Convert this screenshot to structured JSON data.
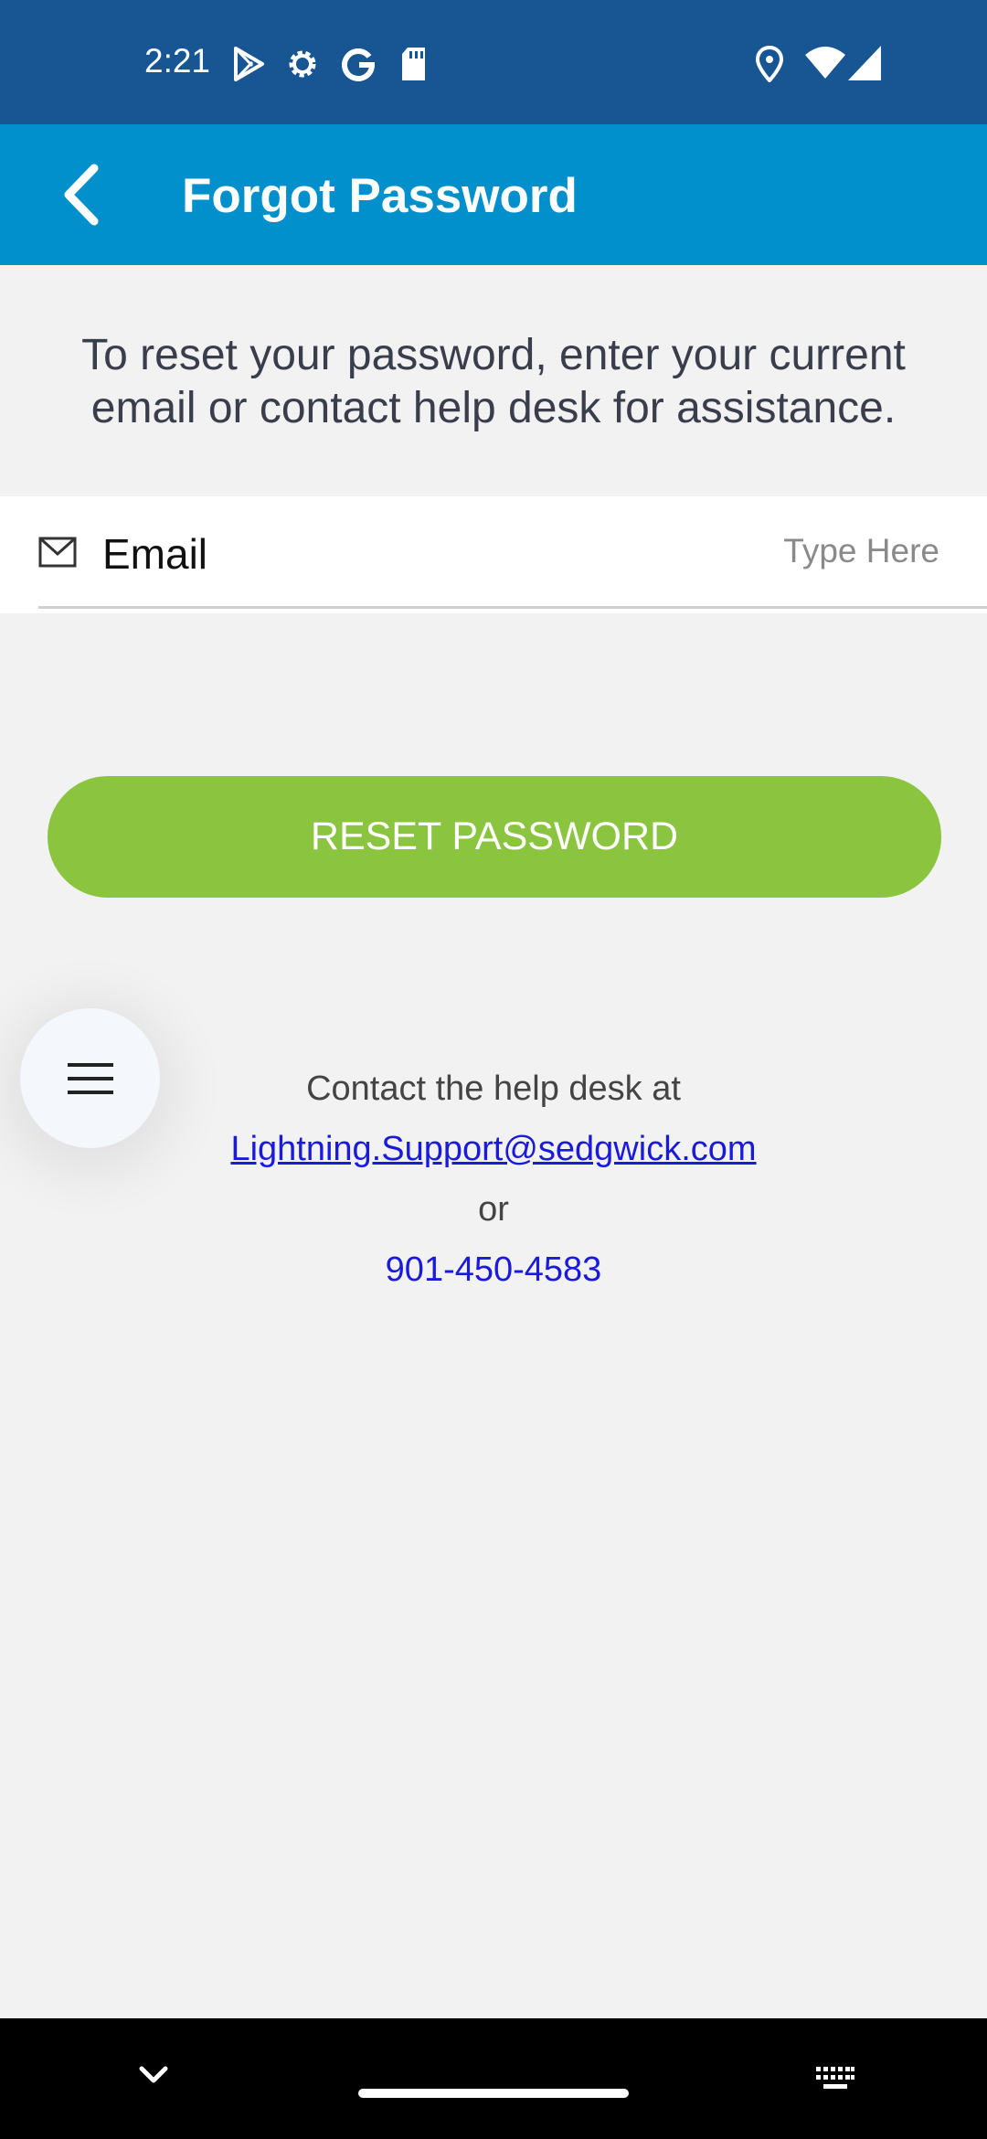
{
  "status_bar": {
    "time": "2:21",
    "icons_left": [
      "play-store-icon",
      "settings-icon",
      "google-icon",
      "sd-card-icon"
    ],
    "icons_right": [
      "location-icon",
      "wifi-icon",
      "cell-signal-icon"
    ]
  },
  "app_bar": {
    "title": "Forgot Password",
    "back_icon": "chevron-left-icon",
    "background": "#0290cc"
  },
  "intro_text": "To reset your password, enter your current email or contact help desk for assistance.",
  "email_field": {
    "icon": "mail-icon",
    "label": "Email",
    "value": "",
    "placeholder": "Type Here"
  },
  "reset_button": {
    "label": "RESET PASSWORD",
    "color": "#8bc540"
  },
  "help": {
    "line1": "Contact the help desk at",
    "email": "Lightning.Support@sedgwick.com",
    "or": "or",
    "phone": "901-450-4583"
  },
  "fab": {
    "icon": "menu-icon"
  },
  "nav_bar": {
    "icons": [
      "chevron-down-icon",
      "home-handle",
      "keyboard-icon"
    ]
  },
  "colors": {
    "status_bar": "#175692",
    "background": "#f2f2f2",
    "link": "#1a1adb"
  }
}
